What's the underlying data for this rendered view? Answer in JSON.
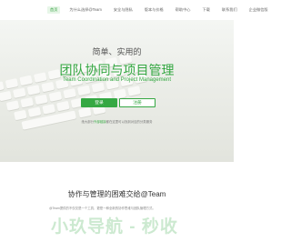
{
  "nav": {
    "items": [
      {
        "label": "首页",
        "active": true
      },
      {
        "label": "为什么选择@Team",
        "active": false
      },
      {
        "label": "安全与隐私",
        "active": false
      },
      {
        "label": "版本与价格",
        "active": false
      },
      {
        "label": "帮助中心",
        "active": false
      },
      {
        "label": "下载",
        "active": false
      },
      {
        "label": "联系我们",
        "active": false
      },
      {
        "label": "企业微信版",
        "active": false
      }
    ]
  },
  "hero": {
    "subtitle": "简单、实用的",
    "title": "团队协同与项目管理",
    "english": "Team Coordination and Project Management",
    "login_label": "登录",
    "register_label": "注册",
    "note_prefix": "绝大部分",
    "note_highlight": "外部链接",
    "note_suffix": "都在这里可以找到对应的分类服务"
  },
  "section": {
    "title": "协作与管理的困难交给@Team",
    "text": "@Team提供的不仅仅是一个工具，更是一种全新的协作思维与团队管理方式。"
  },
  "watermark": {
    "text": "小玖导航 - 秒收"
  }
}
